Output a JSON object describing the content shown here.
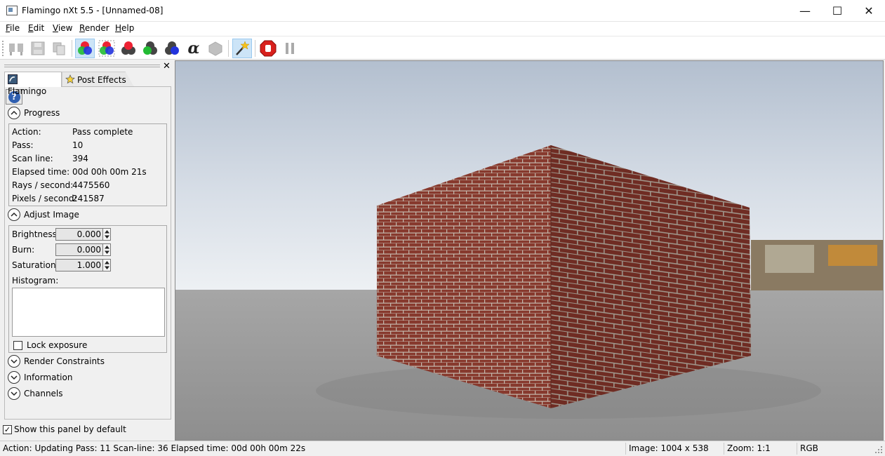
{
  "window": {
    "title": "Flamingo nXt 5.5 - [Unnamed-08]",
    "minimize_glyph": "—",
    "maximize_glyph": "☐",
    "close_glyph": "✕"
  },
  "menu": [
    {
      "underline": "F",
      "rest": "ile"
    },
    {
      "underline": "E",
      "rest": "dit"
    },
    {
      "underline": "V",
      "rest": "iew"
    },
    {
      "underline": "R",
      "rest": "ender"
    },
    {
      "underline": "H",
      "rest": "elp"
    }
  ],
  "toolbar": {
    "icons": [
      "compare-icon",
      "save-icon",
      "copy-icon",
      "rgb-channels-icon",
      "rgb-checker-icon",
      "red-channel-icon",
      "green-channel-icon",
      "blue-channel-icon",
      "alpha-channel-icon",
      "depth-channel-icon",
      "magic-wand-icon",
      "stop-render-icon",
      "pause-render-icon"
    ],
    "alpha_glyph": "α"
  },
  "panel": {
    "close_glyph": "✕",
    "tabs": [
      "Flamingo",
      "Post Effects"
    ],
    "help_glyph": "?",
    "progress": {
      "title": "Progress",
      "rows": [
        {
          "label": "Action:",
          "value": "Pass complete"
        },
        {
          "label": "Pass:",
          "value": "10"
        },
        {
          "label": "Scan line:",
          "value": "394"
        },
        {
          "label": "Elapsed time:",
          "value": "00d 00h 00m 21s"
        },
        {
          "label": "Rays / second:",
          "value": "4475560"
        },
        {
          "label": "Pixels / second:",
          "value": "241587"
        }
      ]
    },
    "adjust_image": {
      "title": "Adjust Image",
      "brightness_label": "Brightness:",
      "brightness_value": "0.000",
      "burn_label": "Burn:",
      "burn_value": "0.000",
      "saturation_label": "Saturation:",
      "saturation_value": "1.000",
      "histogram_label": "Histogram:",
      "lock_exposure_label": "Lock exposure",
      "lock_exposure_checked": false
    },
    "collapsed_sections": [
      "Render Constraints",
      "Information",
      "Channels"
    ],
    "show_default_label": "Show this panel by default",
    "show_default_checked": true,
    "check_glyph": "✓"
  },
  "status": {
    "main": "Action: Updating Pass: 11 Scan-line: 36 Elapsed time: 00d 00h 00m 22s",
    "image": "Image: 1004 x 538",
    "zoom": "Zoom: 1:1",
    "mode": "RGB"
  },
  "colors": {
    "accent": "#cce4f7",
    "brick": "#8a3a2c",
    "sky_top": "#b3bfcf",
    "ground": "#9a9a9a"
  }
}
